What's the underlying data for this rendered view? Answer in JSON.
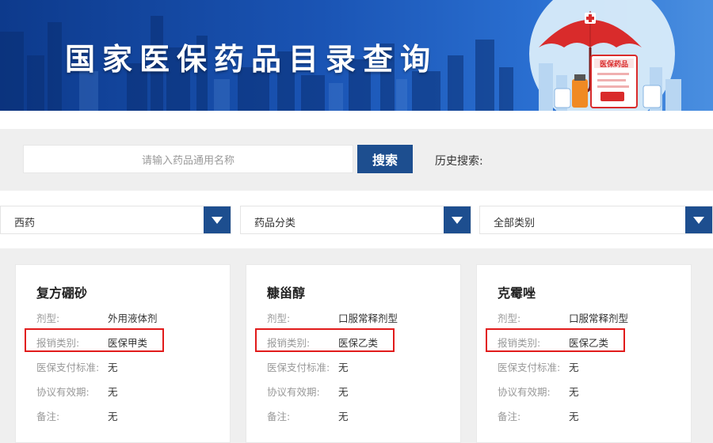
{
  "banner": {
    "title": "国家医保药品目录查询",
    "art_label": "医保药品"
  },
  "search": {
    "placeholder": "请输入药品通用名称",
    "button_label": "搜索",
    "history_label": "历史搜索:"
  },
  "filters": [
    {
      "label": "西药"
    },
    {
      "label": "药品分类"
    },
    {
      "label": "全部类别"
    }
  ],
  "cards": [
    {
      "name": "复方硼砂",
      "rows": [
        {
          "key": "剂型:",
          "value": "外用液体剂"
        },
        {
          "key": "报销类别:",
          "value": "医保甲类"
        },
        {
          "key": "医保支付标准:",
          "value": "无"
        },
        {
          "key": "协议有效期:",
          "value": "无"
        },
        {
          "key": "备注:",
          "value": "无"
        }
      ]
    },
    {
      "name": "糠甾醇",
      "rows": [
        {
          "key": "剂型:",
          "value": "口服常释剂型"
        },
        {
          "key": "报销类别:",
          "value": "医保乙类"
        },
        {
          "key": "医保支付标准:",
          "value": "无"
        },
        {
          "key": "协议有效期:",
          "value": "无"
        },
        {
          "key": "备注:",
          "value": "无"
        }
      ]
    },
    {
      "name": "克霉唑",
      "rows": [
        {
          "key": "剂型:",
          "value": "口服常释剂型"
        },
        {
          "key": "报销类别:",
          "value": "医保乙类"
        },
        {
          "key": "医保支付标准:",
          "value": "无"
        },
        {
          "key": "协议有效期:",
          "value": "无"
        },
        {
          "key": "备注:",
          "value": "无"
        }
      ]
    }
  ],
  "colors": {
    "primary": "#1d4e8f",
    "highlight_border": "#e11b1b",
    "panel_bg": "#efefef"
  },
  "icons": {
    "dropdown": "chevron-down-icon",
    "banner_art": "umbrella-medicine-icon"
  }
}
